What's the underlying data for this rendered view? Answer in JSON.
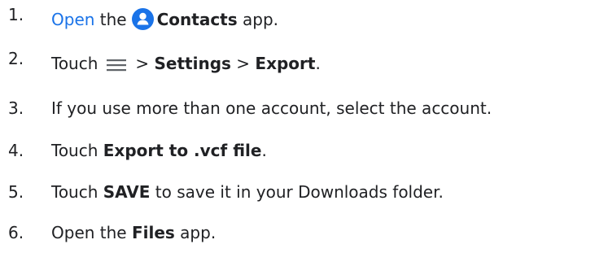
{
  "steps": [
    {
      "number": "1.",
      "parts": [
        "Open",
        "the",
        "Contacts",
        "app."
      ]
    },
    {
      "number": "2.",
      "parts": [
        "Touch",
        ">",
        "Settings",
        ">",
        "Export",
        "."
      ]
    },
    {
      "number": "3.",
      "parts": [
        "If you use more than one account, select the account."
      ]
    },
    {
      "number": "4.",
      "parts": [
        "Touch",
        "Export to .vcf file",
        "."
      ]
    },
    {
      "number": "5.",
      "parts": [
        "Touch",
        "SAVE",
        "to save it in your Downloads folder."
      ]
    },
    {
      "number": "6.",
      "parts": [
        "Open the",
        "Files",
        "app."
      ]
    }
  ],
  "icons": {
    "contacts": "contacts-icon",
    "menu": "menu-icon"
  },
  "colors": {
    "link": "#1a73e8",
    "contacts_icon": "#1a73e8",
    "menu_icon": "#5f6368",
    "text": "#202124"
  }
}
